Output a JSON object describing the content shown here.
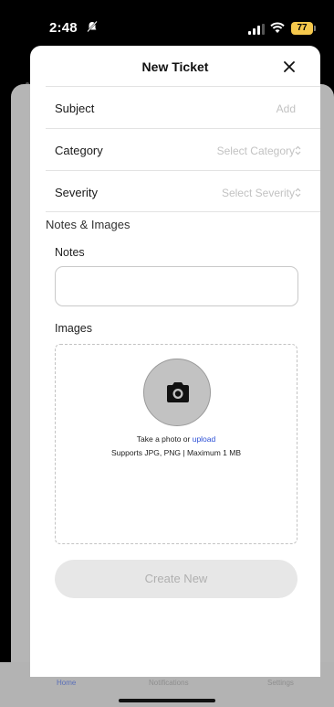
{
  "status_bar": {
    "time": "2:48",
    "battery": "77"
  },
  "sheet": {
    "title": "New Ticket",
    "rows": [
      {
        "label": "Subject",
        "value": "Add"
      },
      {
        "label": "Category",
        "value": "Select Category"
      },
      {
        "label": "Severity",
        "value": "Select Severity"
      }
    ],
    "section_title": "Notes & Images",
    "notes_label": "Notes",
    "notes_value": "",
    "images_label": "Images",
    "dropzone": {
      "line1_prefix": "Take a photo or ",
      "line1_link": "upload",
      "line2": "Supports JPG, PNG | Maximum 1 MB"
    },
    "submit_label": "Create New"
  },
  "bg_tabbar": {
    "home": "Home",
    "notifications": "Notifications",
    "settings": "Settings"
  },
  "colors": {
    "link": "#2b4fd6",
    "battery": "#f5c84c",
    "button_disabled": "#e7e7e7"
  },
  "icons": [
    "mute-icon",
    "signal-icon",
    "wifi-icon",
    "close-icon",
    "chevron-updown-icon",
    "camera-icon"
  ]
}
